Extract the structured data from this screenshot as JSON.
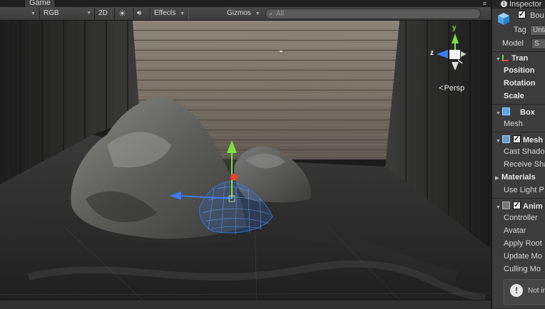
{
  "scene": {
    "tab_label": "Game",
    "shading_mode": "RGB",
    "toggle_2d": "2D",
    "effects_label": "Effects",
    "gizmos_label": "Gizmos",
    "search_placeholder": "All",
    "persp_label": "Persp",
    "gizmo_axes": {
      "y": "y",
      "z": "z"
    }
  },
  "inspector": {
    "tab_label": "Inspector",
    "object_name": "Bou",
    "tag_label": "Tag",
    "tag_value": "Unta",
    "model_label": "Model",
    "model_value": "S",
    "transform": {
      "title": "Tran",
      "rows": [
        "Position",
        "Rotation",
        "Scale"
      ]
    },
    "mesh_filter": {
      "title": "Box",
      "rows": [
        "Mesh"
      ]
    },
    "mesh_renderer": {
      "title": "Mesh",
      "rows": [
        "Cast Shado",
        "Receive Sha",
        "Materials",
        "Use Light P"
      ]
    },
    "animator": {
      "title": "Anim",
      "rows": [
        "Controller",
        "Avatar",
        "Apply Root",
        "Update Mo",
        "Culling Mo"
      ]
    },
    "notice_text": "Not in"
  },
  "colors": {
    "gizmo_y": "#7be03a",
    "gizmo_x": "#e8432d",
    "gizmo_z": "#3c7ef0",
    "mesh_wire": "#2f7dff"
  }
}
